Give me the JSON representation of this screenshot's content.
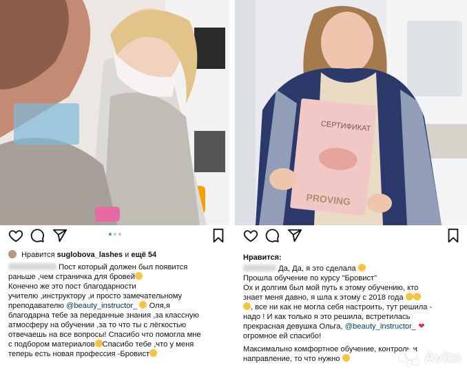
{
  "left_post": {
    "likes_prefix": "Нравится",
    "likes_user": "suglobova_lashes",
    "likes_middle": "и",
    "likes_count": "ещё 54",
    "caption_lines": [
      [
        "Пост который должен был появится"
      ],
      [
        "раньше ,чем страничка для бровей"
      ],
      [
        "Конечно же это пост благодарности"
      ],
      [
        "учителю ,инструктору ,и просто замечательному"
      ],
      [
        "преподавателю ",
        "@beauty_instructor_",
        " Оля,я"
      ],
      [
        "благодарна тебе за переданные знания ,за классную"
      ],
      [
        "атмосферу на обучении ,за то что ты с лёгкостью"
      ],
      [
        "отвечаешь на все вопросы! Спасибо что помогла мне"
      ],
      [
        "с подбором материалов",
        "Спасибо тебе ,что у меня"
      ],
      [
        "теперь есть новая профессия -Бровист"
      ]
    ]
  },
  "right_post": {
    "likes_prefix": "Нравится:",
    "caption_lines": [
      [
        "Да, Да, я это сделала"
      ],
      [
        "Прошла обучение по курсу \"Бровист\""
      ],
      [
        "Ох и долгим был мой путь к этому обучению, кто"
      ],
      [
        "знает меня давно, я шла к этому с 2018 года"
      ],
      [
        ", все ни как не могла себя настроить, тут решила -"
      ],
      [
        "надо ! И как только я это решила, встретилась"
      ],
      [
        "прекрасная девушка Ольга, ",
        "@beauty_instructor_"
      ],
      [
        "огромное ей спасибо!"
      ],
      [
        "Максимально комфортное обучение, контроль и"
      ],
      [
        "направление, то что нужно"
      ]
    ],
    "certificate_text_top": "СЕРТИФИКАТ",
    "certificate_text_bottom": "PROVING"
  },
  "watermark": {
    "text": "Avito"
  },
  "icons": [
    "heart-icon",
    "comment-icon",
    "share-icon",
    "bookmark-icon"
  ]
}
